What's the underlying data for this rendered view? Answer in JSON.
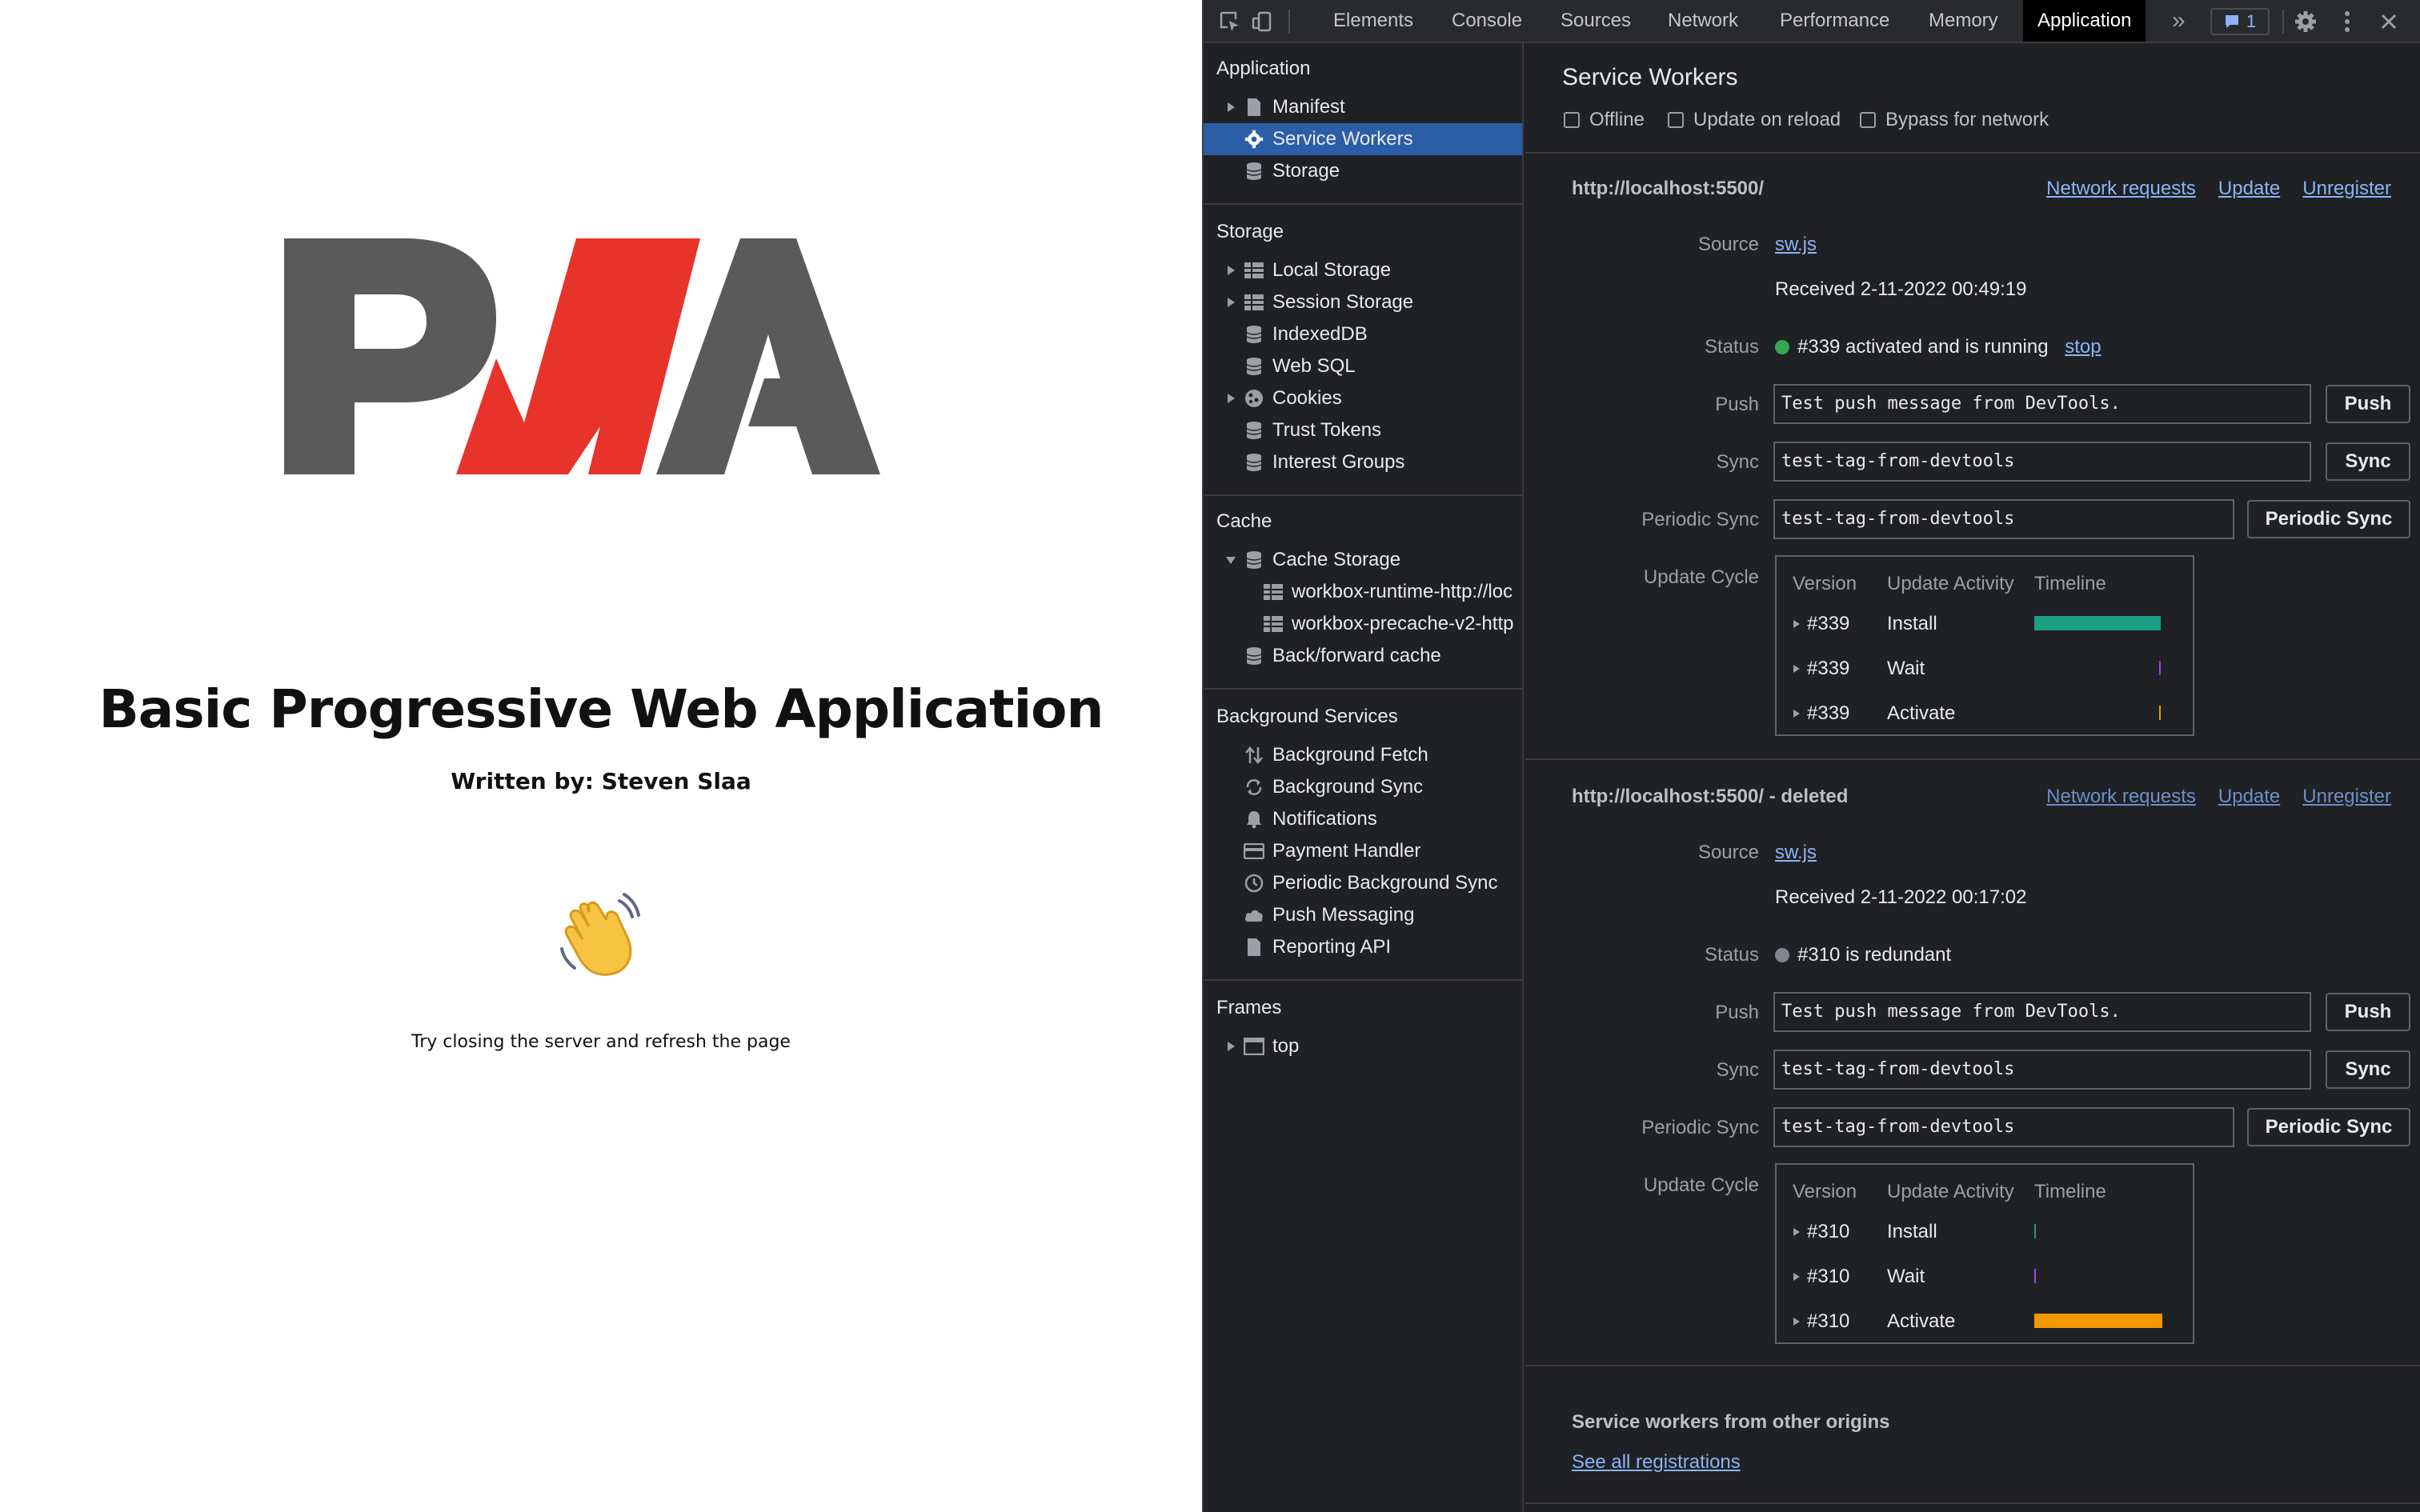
{
  "page": {
    "logo_text": "PWA",
    "title": "Basic Progressive Web Application",
    "author": "Written by: Steven Slaa",
    "hint": "Try closing the server and refresh the page",
    "wave_icon": "waving-hand-icon"
  },
  "devtools": {
    "tabs": [
      "Elements",
      "Console",
      "Sources",
      "Network",
      "Performance",
      "Memory",
      "Application"
    ],
    "active_tab": "Application",
    "more_tabs": "»",
    "issues_count": "1",
    "sidebar": {
      "application_title": "Application",
      "application_items": [
        "Manifest",
        "Service Workers",
        "Storage"
      ],
      "storage_title": "Storage",
      "storage_items": [
        "Local Storage",
        "Session Storage",
        "IndexedDB",
        "Web SQL",
        "Cookies",
        "Trust Tokens",
        "Interest Groups"
      ],
      "cache_title": "Cache",
      "cache_items": [
        "Cache Storage",
        "workbox-runtime-http://loc",
        "workbox-precache-v2-http",
        "Back/forward cache"
      ],
      "background_title": "Background Services",
      "background_items": [
        "Background Fetch",
        "Background Sync",
        "Notifications",
        "Payment Handler",
        "Periodic Background Sync",
        "Push Messaging",
        "Reporting API"
      ],
      "frames_title": "Frames",
      "frames_items": [
        "top"
      ]
    },
    "main": {
      "title": "Service Workers",
      "checkboxes": [
        "Offline",
        "Update on reload",
        "Bypass for network"
      ],
      "link_labels": [
        "Network requests",
        "Update",
        "Unregister"
      ],
      "row_labels": {
        "source": "Source",
        "status": "Status",
        "push": "Push",
        "sync": "Sync",
        "periodic_sync": "Periodic Sync",
        "update_cycle": "Update Cycle"
      },
      "button_labels": {
        "push": "Push",
        "sync": "Sync",
        "periodic_sync": "Periodic Sync"
      },
      "cycle_headers": [
        "Version",
        "Update Activity",
        "Timeline"
      ],
      "workers": [
        {
          "origin": "http://localhost:5500/",
          "source": "sw.js",
          "received": "Received 2-11-2022 00:49:19",
          "status_text": "#339 activated and is running",
          "status_color": "#34a853",
          "stop_label": "stop",
          "push_value": "Test push message from DevTools.",
          "sync_value": "test-tag-from-devtools",
          "periodic_value": "test-tag-from-devtools",
          "cycle": [
            {
              "version": "#339",
              "activity": "Install",
              "color": "#1a9e84"
            },
            {
              "version": "#339",
              "activity": "Wait",
              "color": "#a142f4"
            },
            {
              "version": "#339",
              "activity": "Activate",
              "color": "#f29900"
            }
          ]
        },
        {
          "origin": "http://localhost:5500/ - deleted",
          "source": "sw.js",
          "received": "Received 2-11-2022 00:17:02",
          "status_text": "#310 is redundant",
          "status_color": "#80868b",
          "push_value": "Test push message from DevTools.",
          "sync_value": "test-tag-from-devtools",
          "periodic_value": "test-tag-from-devtools",
          "cycle": [
            {
              "version": "#310",
              "activity": "Install",
              "color": "#1a9e84"
            },
            {
              "version": "#310",
              "activity": "Wait",
              "color": "#a142f4"
            },
            {
              "version": "#310",
              "activity": "Activate",
              "color": "#f29900"
            }
          ]
        }
      ],
      "other_origins_title": "Service workers from other origins",
      "see_all_label": "See all registrations"
    }
  }
}
